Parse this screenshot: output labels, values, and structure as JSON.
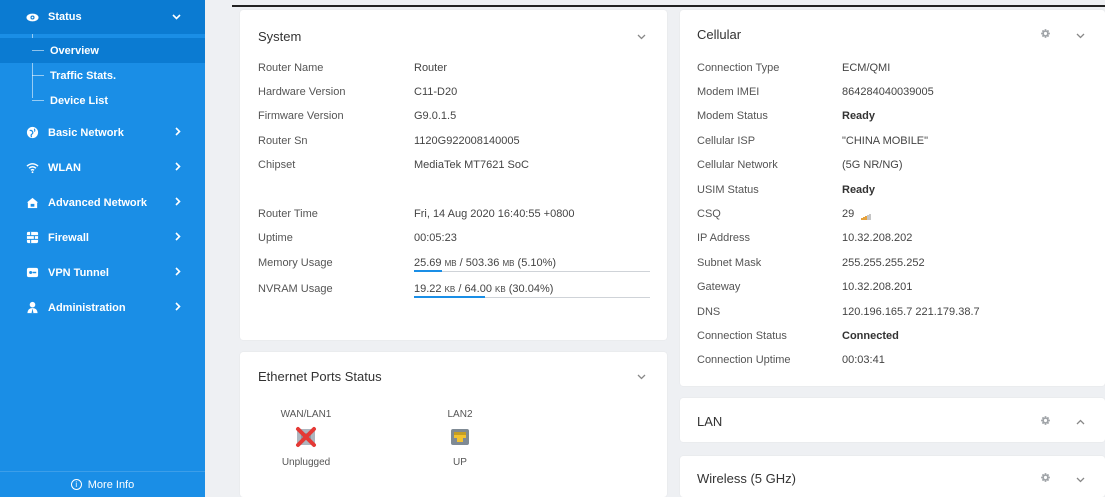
{
  "sidebar": {
    "status": {
      "label": "Status",
      "icon": "eye-icon"
    },
    "sub_items": [
      {
        "label": "Overview",
        "active": true
      },
      {
        "label": "Traffic Stats.",
        "active": false
      },
      {
        "label": "Device List",
        "active": false
      }
    ],
    "items": [
      {
        "label": "Basic Network",
        "icon": "globe-icon"
      },
      {
        "label": "WLAN",
        "icon": "wifi-icon"
      },
      {
        "label": "Advanced Network",
        "icon": "advanced-network-icon"
      },
      {
        "label": "Firewall",
        "icon": "firewall-icon"
      },
      {
        "label": "VPN Tunnel",
        "icon": "vpn-icon"
      },
      {
        "label": "Administration",
        "icon": "administration-icon"
      }
    ],
    "more_info": "More Info"
  },
  "system": {
    "title": "System",
    "rows": [
      {
        "key": "Router Name",
        "value": "Router"
      },
      {
        "key": "Hardware Version",
        "value": "C11-D20"
      },
      {
        "key": "Firmware Version",
        "value": "G9.0.1.5"
      },
      {
        "key": "Router Sn",
        "value": "1120G922008140005"
      },
      {
        "key": "Chipset",
        "value": "MediaTek MT7621 SoC"
      },
      {
        "key": "Router Time",
        "value": "Fri, 14 Aug 2020 16:40:55 +0800"
      },
      {
        "key": "Uptime",
        "value": "00:05:23"
      }
    ],
    "memory": {
      "key": "Memory Usage",
      "used": "25.69",
      "total": "503.36",
      "unit": "MB",
      "percent": "(5.10%)",
      "fraction": 0.051
    },
    "nvram": {
      "key": "NVRAM Usage",
      "used": "19.22",
      "total": "64.00",
      "unit": "KB",
      "percent": "(30.04%)",
      "fraction": 0.3004
    }
  },
  "ethernet": {
    "title": "Ethernet Ports Status",
    "ports": [
      {
        "label": "WAN/LAN1",
        "state": "Unplugged",
        "connected": false
      },
      {
        "label": "LAN2",
        "state": "UP",
        "connected": true
      }
    ]
  },
  "cellular": {
    "title": "Cellular",
    "rows": [
      {
        "key": "Connection Type",
        "value": "ECM/QMI"
      },
      {
        "key": "Modem IMEI",
        "value": "864284040039005"
      },
      {
        "key": "Modem Status",
        "value": "Ready",
        "bold": true
      },
      {
        "key": "Cellular ISP",
        "value": "\"CHINA MOBILE\""
      },
      {
        "key": "Cellular Network",
        "value": "(5G NR/NG)"
      },
      {
        "key": "USIM Status",
        "value": "Ready",
        "bold": true
      },
      {
        "key": "CSQ",
        "value": "29",
        "signal": true
      },
      {
        "key": "IP Address",
        "value": "10.32.208.202"
      },
      {
        "key": "Subnet Mask",
        "value": "255.255.255.252"
      },
      {
        "key": "Gateway",
        "value": "10.32.208.201"
      },
      {
        "key": "DNS",
        "value": "120.196.165.7 221.179.38.7"
      },
      {
        "key": "Connection Status",
        "value": "Connected",
        "bold": true
      },
      {
        "key": "Connection Uptime",
        "value": "00:03:41"
      }
    ]
  },
  "lan": {
    "title": "LAN"
  },
  "wireless": {
    "title": "Wireless (5 GHz)"
  },
  "colors": {
    "sidebar": "#1a8ee6",
    "sidebar_active": "#0b7bd2",
    "bar_fill": "#1a8ee6"
  }
}
